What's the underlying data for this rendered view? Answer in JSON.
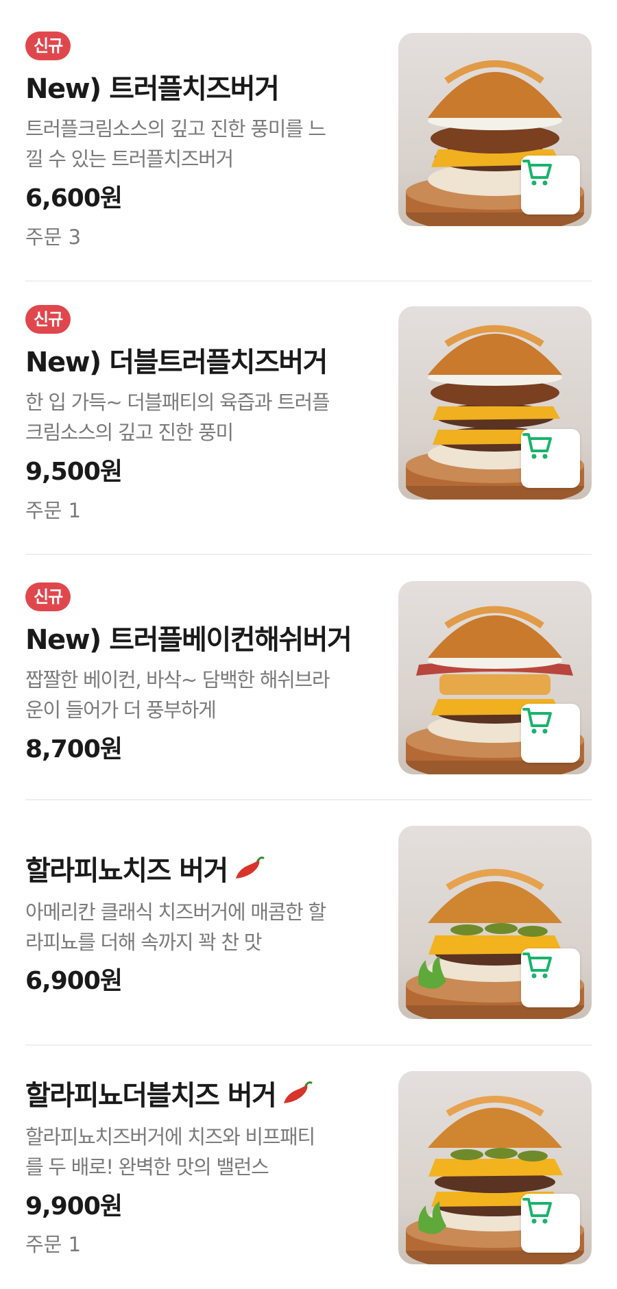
{
  "menu": {
    "items": [
      {
        "badge": "신규",
        "title": "New) 트러플치즈버거",
        "desc_line1": "트러플크림소스의 깊고 진한 풍미를 느",
        "desc_line2": "낄 수 있는 트러플치즈버거",
        "price": "6,600원",
        "orders": "주문 3"
      },
      {
        "badge": "신규",
        "title": "New) 더블트러플치즈버거",
        "desc_line1": "한 입 가득~ 더블패티의 육즙과 트러플",
        "desc_line2": "크림소스의 깊고 진한 풍미",
        "price": "9,500원",
        "orders": "주문 1"
      },
      {
        "badge": "신규",
        "title": "New) 트러플베이컨해쉬버거",
        "desc_line1": "짭짤한 베이컨, 바삭~ 담백한 해쉬브라",
        "desc_line2": "운이 들어가 더 풍부하게",
        "price": "8,700원"
      },
      {
        "title": "할라피뇨치즈 버거",
        "desc_line1": "아메리칸 클래식 치즈버거에 매콤한 할",
        "desc_line2": "라피뇨를 더해 속까지 꽉 찬 맛",
        "price": "6,900원"
      },
      {
        "title": "할라피뇨더블치즈 버거",
        "desc_line1": "할라피뇨치즈버거에 치즈와 비프패티",
        "desc_line2": "를 두 배로! 완벽한 맛의 밸런스",
        "price": "9,900원",
        "orders": "주문 1"
      }
    ]
  },
  "colors": {
    "badge": "#e0474d",
    "cart_icon": "#19b36b",
    "price": "#1a1a1a",
    "desc": "#7a7a7a"
  },
  "icons": {
    "cart": "shopping-cart-icon",
    "spicy": "chili-pepper-icon"
  }
}
